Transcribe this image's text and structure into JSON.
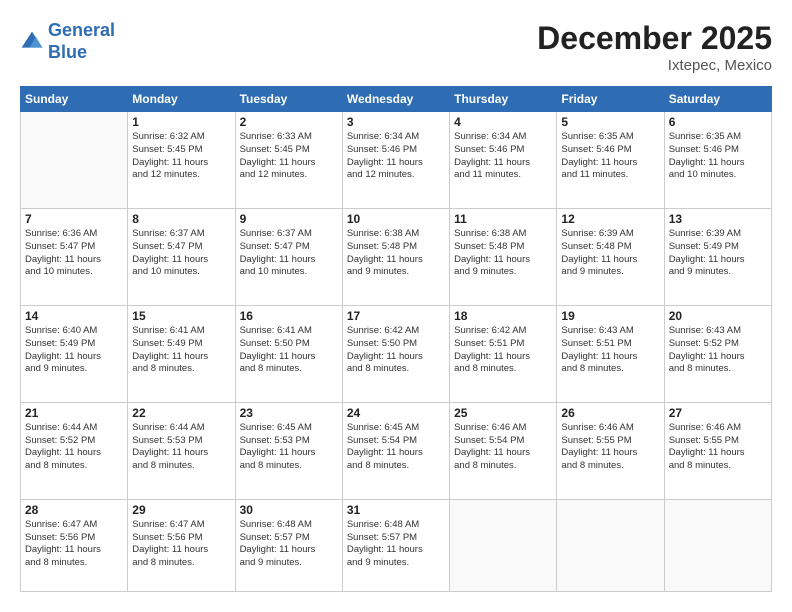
{
  "header": {
    "logo_line1": "General",
    "logo_line2": "Blue",
    "month": "December 2025",
    "location": "Ixtepec, Mexico"
  },
  "days_of_week": [
    "Sunday",
    "Monday",
    "Tuesday",
    "Wednesday",
    "Thursday",
    "Friday",
    "Saturday"
  ],
  "weeks": [
    [
      {
        "num": "",
        "info": ""
      },
      {
        "num": "1",
        "info": "Sunrise: 6:32 AM\nSunset: 5:45 PM\nDaylight: 11 hours\nand 12 minutes."
      },
      {
        "num": "2",
        "info": "Sunrise: 6:33 AM\nSunset: 5:45 PM\nDaylight: 11 hours\nand 12 minutes."
      },
      {
        "num": "3",
        "info": "Sunrise: 6:34 AM\nSunset: 5:46 PM\nDaylight: 11 hours\nand 12 minutes."
      },
      {
        "num": "4",
        "info": "Sunrise: 6:34 AM\nSunset: 5:46 PM\nDaylight: 11 hours\nand 11 minutes."
      },
      {
        "num": "5",
        "info": "Sunrise: 6:35 AM\nSunset: 5:46 PM\nDaylight: 11 hours\nand 11 minutes."
      },
      {
        "num": "6",
        "info": "Sunrise: 6:35 AM\nSunset: 5:46 PM\nDaylight: 11 hours\nand 10 minutes."
      }
    ],
    [
      {
        "num": "7",
        "info": "Sunrise: 6:36 AM\nSunset: 5:47 PM\nDaylight: 11 hours\nand 10 minutes."
      },
      {
        "num": "8",
        "info": "Sunrise: 6:37 AM\nSunset: 5:47 PM\nDaylight: 11 hours\nand 10 minutes."
      },
      {
        "num": "9",
        "info": "Sunrise: 6:37 AM\nSunset: 5:47 PM\nDaylight: 11 hours\nand 10 minutes."
      },
      {
        "num": "10",
        "info": "Sunrise: 6:38 AM\nSunset: 5:48 PM\nDaylight: 11 hours\nand 9 minutes."
      },
      {
        "num": "11",
        "info": "Sunrise: 6:38 AM\nSunset: 5:48 PM\nDaylight: 11 hours\nand 9 minutes."
      },
      {
        "num": "12",
        "info": "Sunrise: 6:39 AM\nSunset: 5:48 PM\nDaylight: 11 hours\nand 9 minutes."
      },
      {
        "num": "13",
        "info": "Sunrise: 6:39 AM\nSunset: 5:49 PM\nDaylight: 11 hours\nand 9 minutes."
      }
    ],
    [
      {
        "num": "14",
        "info": "Sunrise: 6:40 AM\nSunset: 5:49 PM\nDaylight: 11 hours\nand 9 minutes."
      },
      {
        "num": "15",
        "info": "Sunrise: 6:41 AM\nSunset: 5:49 PM\nDaylight: 11 hours\nand 8 minutes."
      },
      {
        "num": "16",
        "info": "Sunrise: 6:41 AM\nSunset: 5:50 PM\nDaylight: 11 hours\nand 8 minutes."
      },
      {
        "num": "17",
        "info": "Sunrise: 6:42 AM\nSunset: 5:50 PM\nDaylight: 11 hours\nand 8 minutes."
      },
      {
        "num": "18",
        "info": "Sunrise: 6:42 AM\nSunset: 5:51 PM\nDaylight: 11 hours\nand 8 minutes."
      },
      {
        "num": "19",
        "info": "Sunrise: 6:43 AM\nSunset: 5:51 PM\nDaylight: 11 hours\nand 8 minutes."
      },
      {
        "num": "20",
        "info": "Sunrise: 6:43 AM\nSunset: 5:52 PM\nDaylight: 11 hours\nand 8 minutes."
      }
    ],
    [
      {
        "num": "21",
        "info": "Sunrise: 6:44 AM\nSunset: 5:52 PM\nDaylight: 11 hours\nand 8 minutes."
      },
      {
        "num": "22",
        "info": "Sunrise: 6:44 AM\nSunset: 5:53 PM\nDaylight: 11 hours\nand 8 minutes."
      },
      {
        "num": "23",
        "info": "Sunrise: 6:45 AM\nSunset: 5:53 PM\nDaylight: 11 hours\nand 8 minutes."
      },
      {
        "num": "24",
        "info": "Sunrise: 6:45 AM\nSunset: 5:54 PM\nDaylight: 11 hours\nand 8 minutes."
      },
      {
        "num": "25",
        "info": "Sunrise: 6:46 AM\nSunset: 5:54 PM\nDaylight: 11 hours\nand 8 minutes."
      },
      {
        "num": "26",
        "info": "Sunrise: 6:46 AM\nSunset: 5:55 PM\nDaylight: 11 hours\nand 8 minutes."
      },
      {
        "num": "27",
        "info": "Sunrise: 6:46 AM\nSunset: 5:55 PM\nDaylight: 11 hours\nand 8 minutes."
      }
    ],
    [
      {
        "num": "28",
        "info": "Sunrise: 6:47 AM\nSunset: 5:56 PM\nDaylight: 11 hours\nand 8 minutes."
      },
      {
        "num": "29",
        "info": "Sunrise: 6:47 AM\nSunset: 5:56 PM\nDaylight: 11 hours\nand 8 minutes."
      },
      {
        "num": "30",
        "info": "Sunrise: 6:48 AM\nSunset: 5:57 PM\nDaylight: 11 hours\nand 9 minutes."
      },
      {
        "num": "31",
        "info": "Sunrise: 6:48 AM\nSunset: 5:57 PM\nDaylight: 11 hours\nand 9 minutes."
      },
      {
        "num": "",
        "info": ""
      },
      {
        "num": "",
        "info": ""
      },
      {
        "num": "",
        "info": ""
      }
    ]
  ]
}
